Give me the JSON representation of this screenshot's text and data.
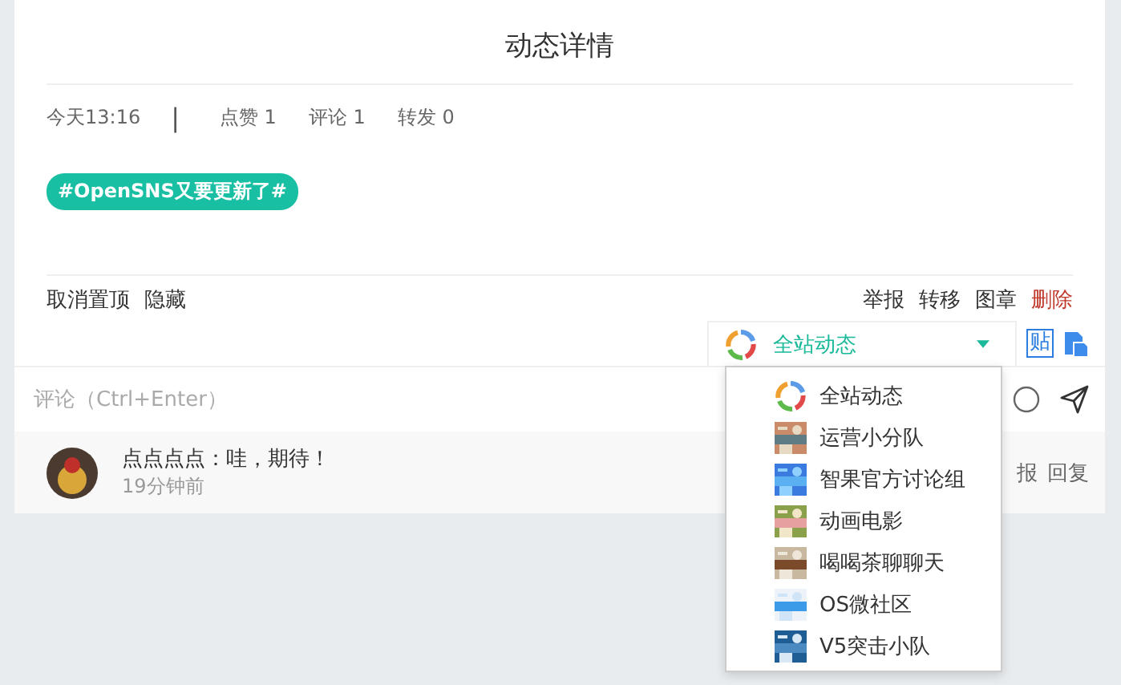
{
  "title": "动态详情",
  "meta": {
    "time": "今天13:16",
    "separator": "|",
    "stats": [
      "点赞 1",
      "评论 1",
      "转发 0"
    ]
  },
  "topic_tag": "#OpenSNS又要更新了#",
  "left_actions": [
    "取消置顶",
    "隐藏"
  ],
  "right_actions": [
    {
      "label": "举报",
      "kind": "normal"
    },
    {
      "label": "转移",
      "kind": "normal"
    },
    {
      "label": "图章",
      "kind": "normal"
    },
    {
      "label": "删除",
      "kind": "danger"
    }
  ],
  "group_select": {
    "value": "全站动态",
    "expanded": true,
    "options": [
      {
        "label": "全站动态",
        "kind": "ring"
      },
      {
        "label": "运营小分队",
        "kind": "picture"
      },
      {
        "label": "智果官方讨论组",
        "kind": "picture"
      },
      {
        "label": "动画电影",
        "kind": "picture"
      },
      {
        "label": "喝喝茶聊聊天",
        "kind": "picture"
      },
      {
        "label": "OS微社区",
        "kind": "picture"
      },
      {
        "label": "V5突击小队",
        "kind": "picture"
      }
    ]
  },
  "share_badge": "贴",
  "comment_input": {
    "placeholder": "评论（Ctrl+Enter）"
  },
  "comments": [
    {
      "author_text": "点点点点：哇，期待！",
      "time": "19分钟前",
      "actions": [
        "报",
        "回复"
      ]
    }
  ]
}
